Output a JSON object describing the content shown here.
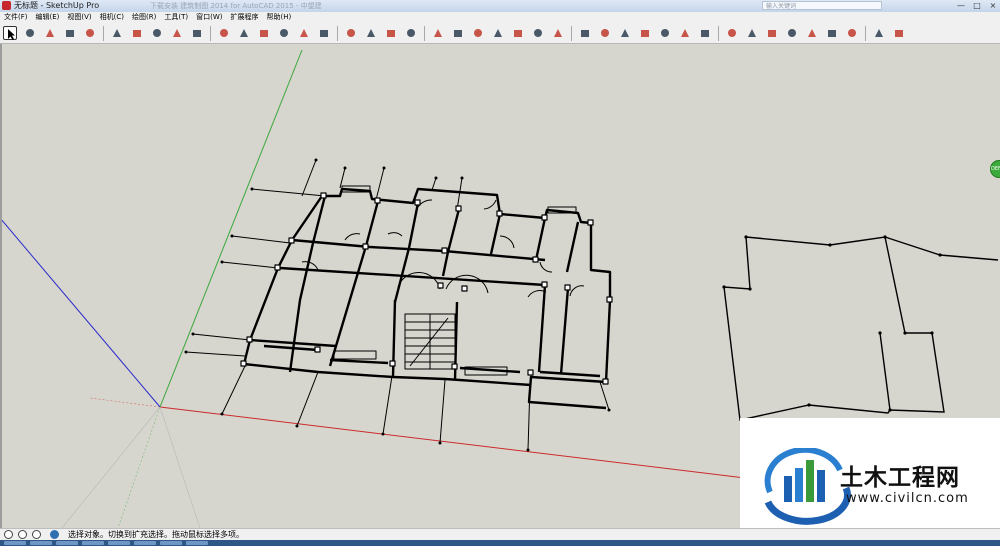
{
  "window": {
    "title": "无标题 - SketchUp Pro",
    "background_title": "下载安装 建筑制图 2014 for AutoCAD 2015 - 中望建",
    "search_placeholder": "输入关键词",
    "controls": [
      "—",
      "□",
      "×"
    ]
  },
  "menu": [
    "文件(F)",
    "编辑(E)",
    "视图(V)",
    "相机(C)",
    "绘图(R)",
    "工具(T)",
    "窗口(W)",
    "扩展程序",
    "帮助(H)"
  ],
  "toolbar": {
    "groups": [
      [
        "select-tool-icon",
        "eraser-icon",
        "line-icon",
        "arc-icon",
        "rectangle-icon"
      ],
      [
        "push-pull-icon",
        "move-icon",
        "rotate-icon",
        "scale-icon",
        "offset-icon"
      ],
      [
        "tape-measure-icon",
        "text-icon",
        "orbit-icon",
        "pan-icon",
        "zoom-icon",
        "zoom-extents-icon"
      ],
      [
        "warehouse-icon",
        "extension-warehouse-icon",
        "send-to-layout-icon",
        "components-icon"
      ],
      [
        "iso-view-icon",
        "top-view-icon",
        "front-view-icon",
        "right-view-icon",
        "back-view-icon",
        "left-view-icon",
        "bottom-view-icon"
      ],
      [
        "sandbox-from-contours-icon",
        "sandbox-from-scratch-icon",
        "smoove-icon",
        "stamp-icon",
        "drape-icon",
        "add-detail-icon",
        "flip-edge-icon"
      ],
      [
        "solid-outer-shell-icon",
        "intersect-icon",
        "union-icon",
        "subtract-icon",
        "trim-icon",
        "split-icon",
        "section-plane-icon"
      ],
      [
        "style-xray-icon",
        "style-shaded-icon"
      ]
    ],
    "active_index": 47,
    "icon_color_main": "#c0392b",
    "icon_color_alt": "#2c3e50"
  },
  "statusbar": {
    "icons": [
      "geo-location-icon",
      "credits-icon",
      "user-icon",
      "help-icon"
    ],
    "message": "选择对象。切换到扩充选择。拖动鼠标选择多项。"
  },
  "sidebar_badge": "DEFAULT",
  "watermark": {
    "brand": "土木工程网",
    "url": "www.civilcn.com"
  },
  "colors": {
    "viewport_bg": "#d6d6ce",
    "red_axis": "#cc2a2a",
    "green_axis": "#3aa83a",
    "blue_axis": "#2a2acc",
    "edge": "#000000"
  }
}
